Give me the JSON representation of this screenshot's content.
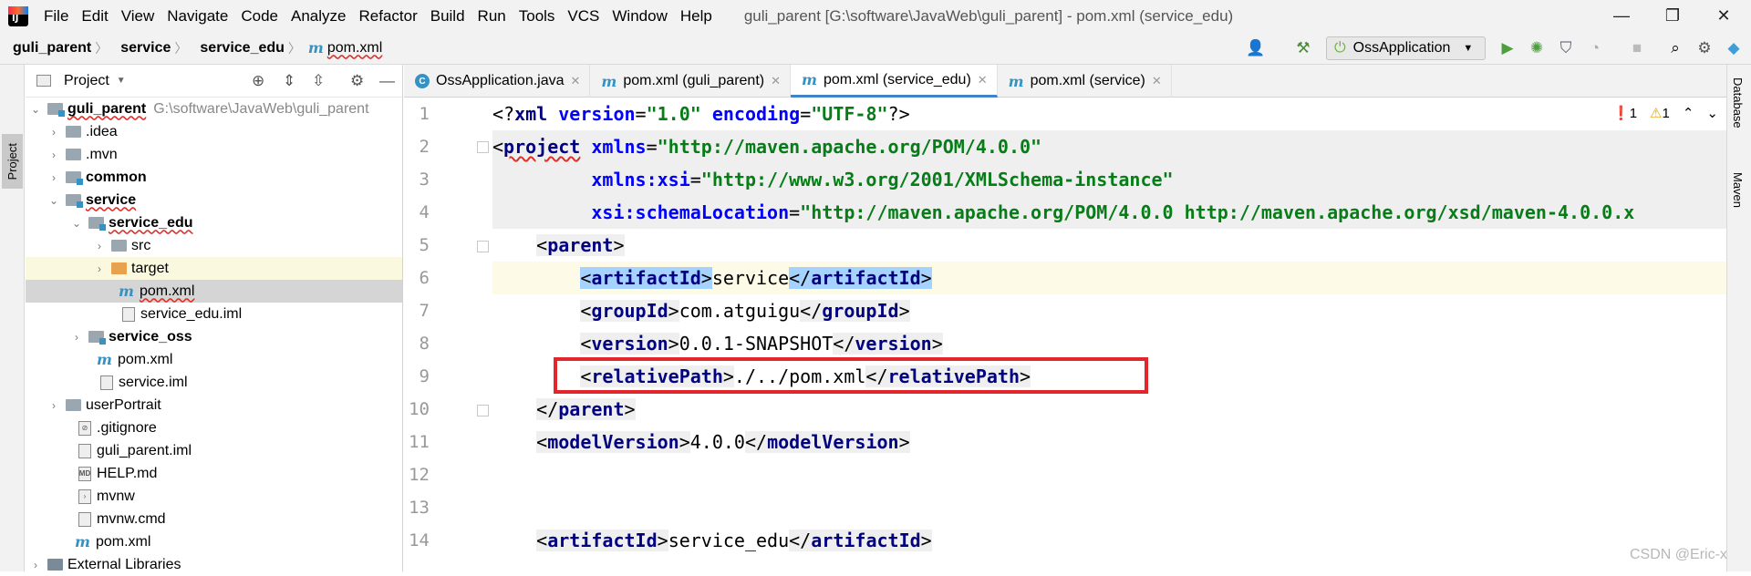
{
  "menubar": {
    "items": [
      "File",
      "Edit",
      "View",
      "Navigate",
      "Code",
      "Analyze",
      "Refactor",
      "Build",
      "Run",
      "Tools",
      "VCS",
      "Window",
      "Help"
    ],
    "window_title": "guli_parent [G:\\software\\JavaWeb\\guli_parent] - pom.xml (service_edu)"
  },
  "breadcrumb": {
    "items": [
      "guli_parent",
      "service",
      "service_edu"
    ],
    "file": "pom.xml"
  },
  "toolbar": {
    "run_config": "OssApplication"
  },
  "project_panel": {
    "title": "Project",
    "root": {
      "name": "guli_parent",
      "path": "G:\\software\\JavaWeb\\guli_parent"
    },
    "rows": [
      {
        "label": ".idea"
      },
      {
        "label": ".mvn"
      },
      {
        "label": "common"
      },
      {
        "label": "service"
      },
      {
        "label": "service_edu"
      },
      {
        "label": "src"
      },
      {
        "label": "target"
      },
      {
        "label": "pom.xml"
      },
      {
        "label": "service_edu.iml"
      },
      {
        "label": "service_oss"
      },
      {
        "label": "pom.xml"
      },
      {
        "label": "service.iml"
      },
      {
        "label": "userPortrait"
      },
      {
        "label": ".gitignore"
      },
      {
        "label": "guli_parent.iml"
      },
      {
        "label": "HELP.md"
      },
      {
        "label": "mvnw"
      },
      {
        "label": "mvnw.cmd"
      },
      {
        "label": "pom.xml"
      },
      {
        "label": "External Libraries"
      }
    ]
  },
  "left_strip": {
    "tab": "Project"
  },
  "right_strip": {
    "tabs": [
      "Database",
      "Maven"
    ]
  },
  "editor_tabs": [
    "OssApplication.java",
    "pom.xml (guli_parent)",
    "pom.xml (service_edu)",
    "pom.xml (service)"
  ],
  "inspections": {
    "errors": "1",
    "warnings": "1"
  },
  "editor": {
    "line_numbers": [
      "1",
      "2",
      "3",
      "4",
      "5",
      "6",
      "7",
      "8",
      "9",
      "10",
      "11",
      "12",
      "13",
      "14"
    ],
    "l1": {
      "a": "<?",
      "b": "xml",
      "c": " version",
      "d": "=",
      "e": "\"1.0\"",
      "f": " encoding",
      "g": "=",
      "h": "\"UTF-8\"",
      "i": "?>"
    },
    "l2": {
      "a": "<",
      "b": "project",
      "c": " xmlns",
      "d": "=",
      "e": "\"http://maven.apache.org/POM/4.0.0\""
    },
    "l3": {
      "c": "xmlns:xsi",
      "d": "=",
      "e": "\"http://www.w3.org/2001/XMLSchema-instance\""
    },
    "l4": {
      "c": "xsi:schemaLocation",
      "d": "=",
      "e": "\"http://maven.apache.org/POM/4.0.0 http://maven.apache.org/xsd/maven-4.0.0.x"
    },
    "l5": {
      "open": "<",
      "tag": "parent",
      "close": ">"
    },
    "l6": {
      "tag": "artifactId",
      "value": "service"
    },
    "l7": {
      "tag": "groupId",
      "value": "com.atguigu"
    },
    "l8": {
      "tag": "version",
      "value": "0.0.1-SNAPSHOT"
    },
    "l9": {
      "tag": "relativePath",
      "value": "./../pom.xml"
    },
    "l10": {
      "tag": "parent"
    },
    "l11": {
      "tag": "modelVersion",
      "value": "4.0.0"
    },
    "l14": {
      "tag": "artifactId",
      "value": "service_edu"
    }
  },
  "watermark": "CSDN @Eric-x",
  "colors": {
    "tag": "#000080",
    "string": "#067d17",
    "highlight_box": "#e2262b",
    "selection": "#a6d2ff"
  }
}
